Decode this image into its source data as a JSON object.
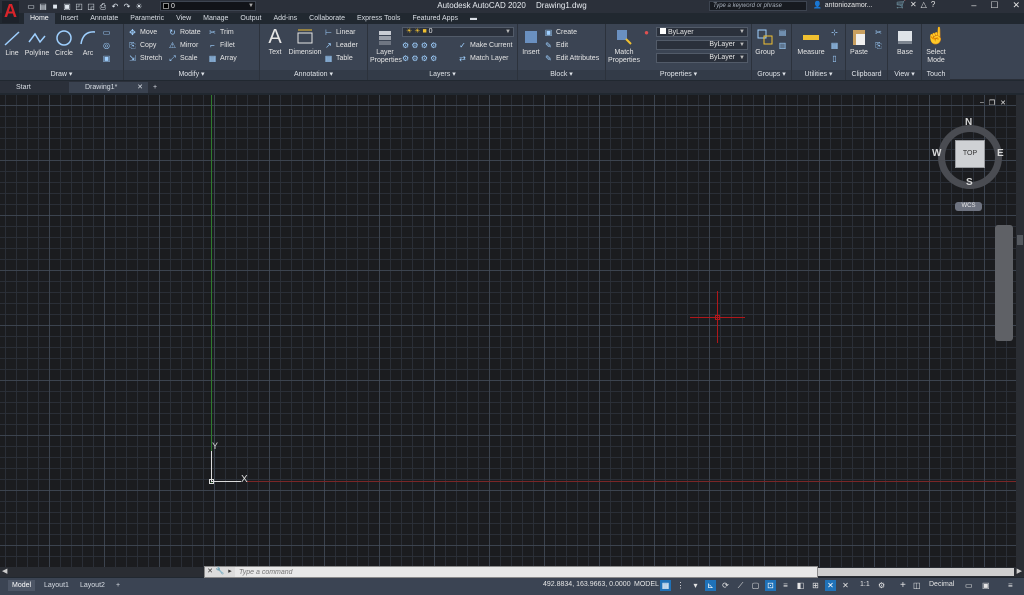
{
  "title": {
    "app": "Autodesk AutoCAD 2020",
    "file": "Drawing1.dwg"
  },
  "app_logo": "A",
  "quick_access": {
    "icons": [
      "new-file-icon",
      "open-file-icon",
      "save-icon",
      "save-as-icon",
      "plot-icon",
      "undo-icon",
      "redo-icon",
      "layer-state-icon"
    ],
    "layer_value": "0"
  },
  "search": {
    "placeholder": "Type a keyword or phrase"
  },
  "user": {
    "name": "antoniozamor..."
  },
  "ribbon_tabs": [
    "Home",
    "Insert",
    "Annotate",
    "Parametric",
    "View",
    "Manage",
    "Output",
    "Add-ins",
    "Collaborate",
    "Express Tools",
    "Featured Apps"
  ],
  "ribbon": {
    "draw": {
      "title": "Draw",
      "line": "Line",
      "polyline": "Polyline",
      "circle": "Circle",
      "arc": "Arc"
    },
    "modify": {
      "title": "Modify",
      "move": "Move",
      "rotate": "Rotate",
      "trim": "Trim",
      "copy": "Copy",
      "mirror": "Mirror",
      "fillet": "Fillet",
      "stretch": "Stretch",
      "scale": "Scale",
      "array": "Array"
    },
    "annotation": {
      "title": "Annotation",
      "text": "Text",
      "dimension": "Dimension",
      "linear": "Linear",
      "leader": "Leader",
      "table": "Table"
    },
    "layers": {
      "title": "Layers",
      "layer_properties_1": "Layer",
      "layer_properties_2": "Properties",
      "current_layer": "0",
      "make_current": "Make Current",
      "match_layer": "Match Layer"
    },
    "block": {
      "title": "Block",
      "insert": "Insert",
      "create": "Create",
      "edit": "Edit",
      "edit_attributes": "Edit Attributes"
    },
    "properties": {
      "title": "Properties",
      "match_1": "Match",
      "match_2": "Properties",
      "color": "ByLayer",
      "linetype": "ByLayer",
      "lineweight": "ByLayer"
    },
    "groups": {
      "title": "Groups",
      "group": "Group"
    },
    "utilities": {
      "title": "Utilities",
      "measure": "Measure"
    },
    "clipboard": {
      "title": "Clipboard",
      "paste": "Paste"
    },
    "view": {
      "title": "View",
      "base": "Base"
    },
    "touch": {
      "title": "Touch",
      "select_1": "Select",
      "select_2": "Mode"
    }
  },
  "file_tabs": {
    "start": "Start",
    "drawing": "Drawing1*"
  },
  "viewcube": {
    "north": "N",
    "south": "S",
    "east": "E",
    "west": "W",
    "face": "TOP",
    "coord_system": "WCS"
  },
  "ucs_icon": {
    "x_label": "X",
    "y_label": "Y"
  },
  "command_line": {
    "placeholder": "Type a command"
  },
  "layout_tabs": [
    "Model",
    "Layout1",
    "Layout2"
  ],
  "status": {
    "coordinates": "492.8834, 163.9663, 0.0000",
    "space": "MODEL",
    "annotation_scale": "1:1",
    "units": "Decimal"
  },
  "colors": {
    "canvas": "#1b1c1f",
    "ribbon": "#3b4453",
    "crosshair": "#b0171a",
    "y_axis": "#2f7a2e",
    "accent": "#1f72b8",
    "logo": "#d8242a"
  }
}
